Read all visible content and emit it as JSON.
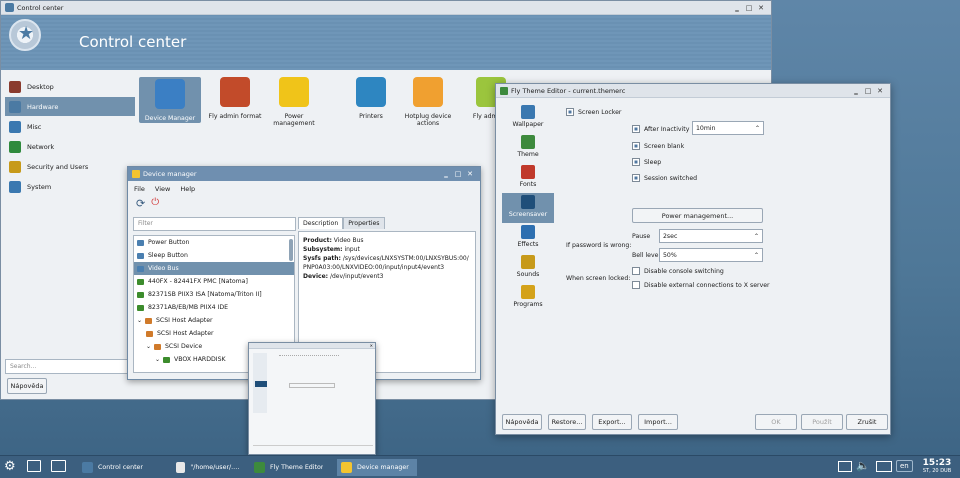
{
  "control_center": {
    "window_title": "Control center",
    "banner_title": "Control center",
    "sidebar": [
      {
        "label": "Desktop",
        "icon": "desktop-icon",
        "selected": false
      },
      {
        "label": "Hardware",
        "icon": "hardware-icon",
        "selected": true
      },
      {
        "label": "Misc",
        "icon": "misc-icon",
        "selected": false
      },
      {
        "label": "Network",
        "icon": "network-icon",
        "selected": false
      },
      {
        "label": "Security and Users",
        "icon": "security-icon",
        "selected": false
      },
      {
        "label": "System",
        "icon": "gear-icon",
        "selected": false
      }
    ],
    "search_placeholder": "Search...",
    "help_button": "Nápověda",
    "tiles": [
      {
        "label": "Device Manager",
        "icon": "info-icon",
        "selected": true
      },
      {
        "label": "Fly admin format",
        "icon": "disk-format-icon",
        "selected": false
      },
      {
        "label": "Power management",
        "icon": "power-warning-icon",
        "selected": false
      },
      {
        "label": "Printers",
        "icon": "printer-icon",
        "selected": false
      },
      {
        "label": "Hotplug device actions",
        "icon": "usb-icon",
        "selected": false
      },
      {
        "label": "Fly admin u",
        "icon": "usb-stick-icon",
        "selected": false
      }
    ]
  },
  "device_manager": {
    "window_title": "Device manager",
    "menu": [
      "File",
      "View",
      "Help"
    ],
    "filter_placeholder": "Filter",
    "tabs": [
      "Description",
      "Properties"
    ],
    "tree": [
      {
        "label": "Power Button",
        "indent": 0,
        "selected": false,
        "color": "#4a7fb0"
      },
      {
        "label": "Sleep Button",
        "indent": 0,
        "selected": false,
        "color": "#4a7fb0"
      },
      {
        "label": "Video Bus",
        "indent": 0,
        "selected": true,
        "color": "#4a7fb0"
      },
      {
        "label": "440FX - 82441FX PMC [Natoma]",
        "indent": 0,
        "selected": false,
        "color": "#3c8c2c"
      },
      {
        "label": "82371SB PIIX3 ISA [Natoma/Triton II]",
        "indent": 0,
        "selected": false,
        "color": "#3c8c2c"
      },
      {
        "label": "82371AB/EB/MB PIIX4 IDE",
        "indent": 0,
        "selected": false,
        "color": "#3c8c2c"
      },
      {
        "label": "SCSI Host Adapter",
        "indent": 0,
        "selected": false,
        "color": "#d07a2a",
        "arrow": "v"
      },
      {
        "label": "SCSI Host Adapter",
        "indent": 1,
        "selected": false,
        "color": "#d07a2a"
      },
      {
        "label": "SCSI Device",
        "indent": 1,
        "selected": false,
        "color": "#d07a2a",
        "arrow": "v"
      },
      {
        "label": "VBOX HARDDISK",
        "indent": 2,
        "selected": false,
        "color": "#3c8c2c",
        "arrow": "v"
      }
    ],
    "description": [
      {
        "key": "Product:",
        "value": "Video Bus"
      },
      {
        "key": "Subsystem:",
        "value": "input"
      },
      {
        "key": "Sysfs path:",
        "value": "/sys/devices/LNXSYSTM:00/LNXSYBUS:00/PNP0A03:00/LNXVIDEO:00/input/input4/event3"
      },
      {
        "key": "Device:",
        "value": "/dev/input/event3"
      }
    ]
  },
  "theme_editor": {
    "window_title": "Fly Theme Editor - current.themerc",
    "categories": [
      {
        "label": "Wallpaper",
        "selected": false,
        "color": "#3a78b0"
      },
      {
        "label": "Theme",
        "selected": false,
        "color": "#3d8a3d"
      },
      {
        "label": "Fonts",
        "selected": false,
        "color": "#c0392b"
      },
      {
        "label": "Screensaver",
        "selected": true,
        "color": "#1f4e79"
      },
      {
        "label": "Effects",
        "selected": false,
        "color": "#2d6fb0"
      },
      {
        "label": "Sounds",
        "selected": false,
        "color": "#c79a1a"
      },
      {
        "label": "Programs",
        "selected": false,
        "color": "#d4a21a"
      }
    ],
    "screen_locker": "Screen Locker",
    "after_inactivity": "After Inactivity",
    "after_inactivity_value": "10min",
    "screen_blank": "Screen blank",
    "sleep": "Sleep",
    "session_switched": "Session switched",
    "power_mgmt_button": "Power management...",
    "if_password_wrong": "If password is wrong:",
    "pause_label": "Pause",
    "pause_value": "2sec",
    "bell_label": "Bell level",
    "bell_value": "50%",
    "when_locked": "When screen locked:",
    "disable_console": "Disable console switching",
    "disable_external": "Disable external connections to X server",
    "buttons": {
      "help": "Nápověda",
      "restore": "Restore...",
      "export": "Export...",
      "import": "Import...",
      "ok": "OK",
      "apply": "Použít",
      "cancel": "Zrušit"
    }
  },
  "taskbar": {
    "items": [
      {
        "label": "Control center",
        "active": false
      },
      {
        "label": "\"/home/user/.fly/...",
        "active": false
      },
      {
        "label": "Fly Theme Editor",
        "active": false
      },
      {
        "label": "Device manager",
        "active": true
      }
    ],
    "lang": "en",
    "time": "15:23",
    "date": "ST, 20 DUB"
  },
  "colors": {
    "accent": "#7191ad",
    "titlebar_active": "#6f8fb0",
    "taskbar": "#3c5f7f"
  }
}
